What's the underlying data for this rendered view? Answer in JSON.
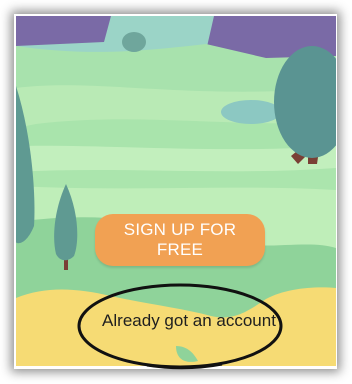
{
  "onboarding": {
    "signup_button_label": "SIGN UP FOR FREE",
    "login_link_label": "Already got an account"
  },
  "colors": {
    "accent": "#f1a153",
    "sky": "#9bd4c7",
    "grass_light": "#b7e8b0",
    "grass_mid": "#8fd39a",
    "tree": "#5a9492",
    "trunk": "#7a3f35",
    "mountain": "#7a6aa6",
    "sand": "#f6db74"
  },
  "icons": [
    "tree-icon",
    "mountain-icon"
  ]
}
